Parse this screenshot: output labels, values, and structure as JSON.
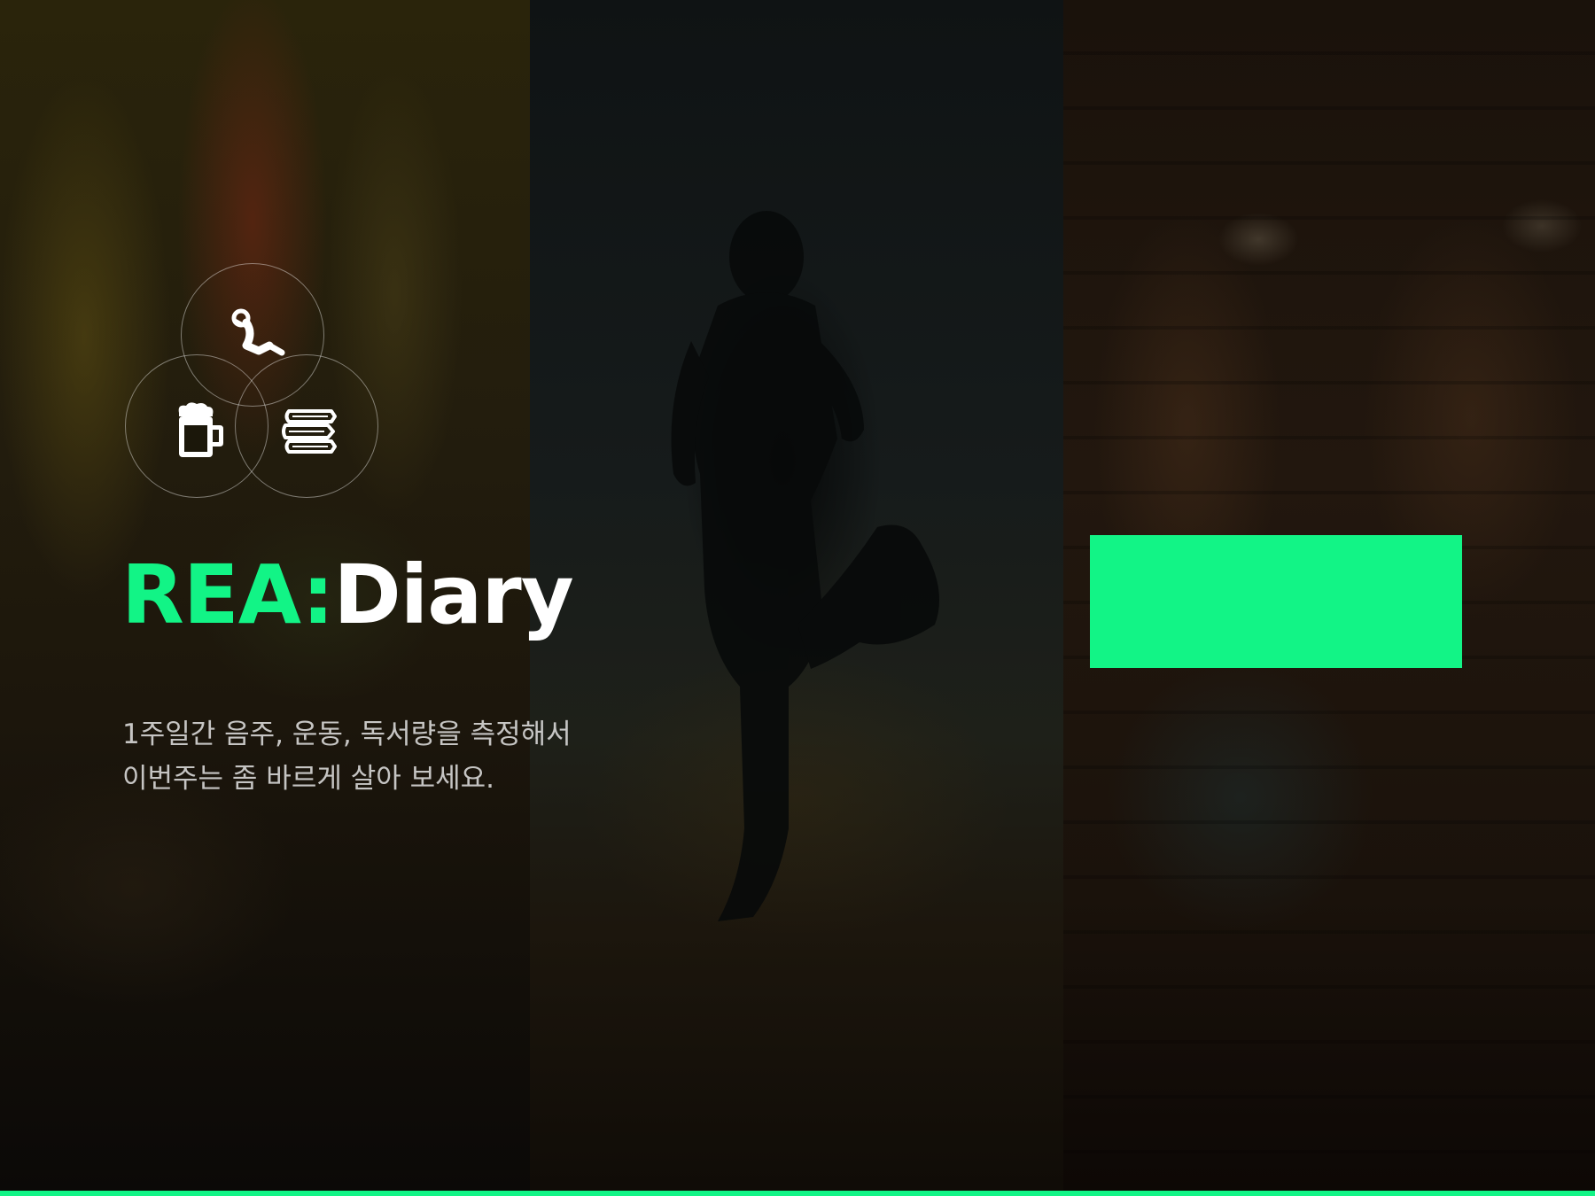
{
  "app": {
    "title_accent": "REA:",
    "title_rest": "Diary"
  },
  "tagline": {
    "line1": "1주일간 음주, 운동, 독서량을 측정해서",
    "line2": "이번주는 좀 바르게 살아 보세요."
  },
  "icons": [
    "situp-icon",
    "beer-icon",
    "books-icon"
  ],
  "colors": {
    "accent": "#12f486",
    "title_white": "#ffffff",
    "background": "#050505"
  }
}
